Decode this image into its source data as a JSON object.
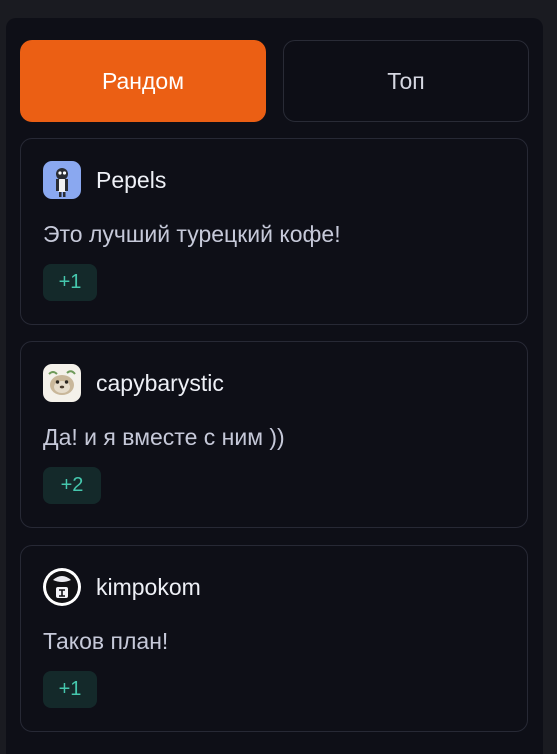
{
  "tabs": {
    "random_label": "Рандом",
    "top_label": "Топ"
  },
  "comments": [
    {
      "username": "Pepels",
      "text": "Это лучший турецкий кофе!",
      "votes": "+1",
      "avatar_icon": "cartoon-character-avatar-icon"
    },
    {
      "username": "capybarystic",
      "text": "Да! и я вместе с ним ))",
      "votes": "+2",
      "avatar_icon": "capybara-avatar-icon"
    },
    {
      "username": "kimpokom",
      "text": "Таков план!",
      "votes": "+1",
      "avatar_icon": "black-white-avatar-icon"
    }
  ],
  "colors": {
    "accent": "#eb5f14",
    "background": "#0e0f17",
    "vote_text": "#45c7ad",
    "vote_bg": "#14292a"
  }
}
